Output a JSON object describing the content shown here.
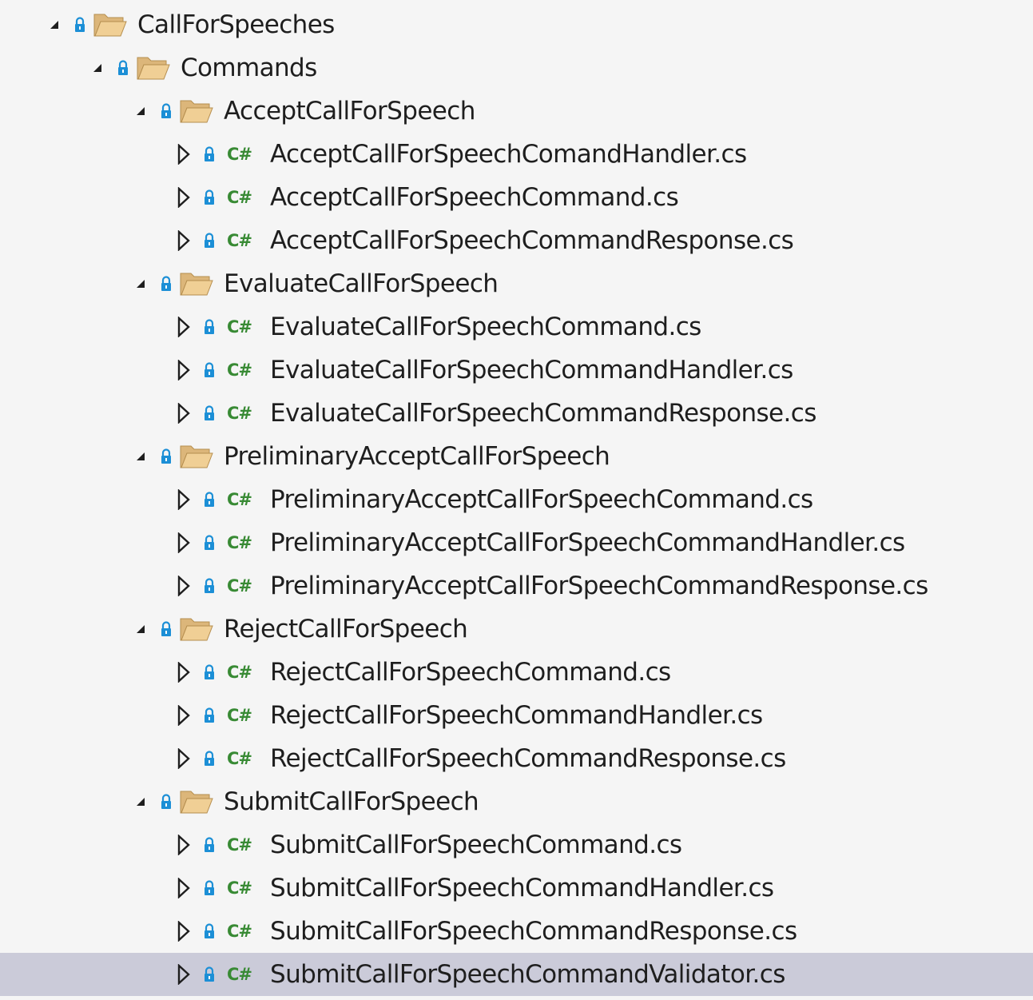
{
  "tree": {
    "items": [
      {
        "type": "folder",
        "level": 0,
        "label": "CallForSpeeches",
        "expanded": true
      },
      {
        "type": "folder",
        "level": 1,
        "label": "Commands",
        "expanded": true
      },
      {
        "type": "folder",
        "level": 2,
        "label": "AcceptCallForSpeech",
        "expanded": true
      },
      {
        "type": "file",
        "level": 3,
        "label": "AcceptCallForSpeechComandHandler.cs",
        "expanded": false
      },
      {
        "type": "file",
        "level": 3,
        "label": "AcceptCallForSpeechCommand.cs",
        "expanded": false
      },
      {
        "type": "file",
        "level": 3,
        "label": "AcceptCallForSpeechCommandResponse.cs",
        "expanded": false
      },
      {
        "type": "folder",
        "level": 2,
        "label": "EvaluateCallForSpeech",
        "expanded": true
      },
      {
        "type": "file",
        "level": 3,
        "label": "EvaluateCallForSpeechCommand.cs",
        "expanded": false
      },
      {
        "type": "file",
        "level": 3,
        "label": "EvaluateCallForSpeechCommandHandler.cs",
        "expanded": false
      },
      {
        "type": "file",
        "level": 3,
        "label": "EvaluateCallForSpeechCommandResponse.cs",
        "expanded": false
      },
      {
        "type": "folder",
        "level": 2,
        "label": "PreliminaryAcceptCallForSpeech",
        "expanded": true
      },
      {
        "type": "file",
        "level": 3,
        "label": "PreliminaryAcceptCallForSpeechCommand.cs",
        "expanded": false
      },
      {
        "type": "file",
        "level": 3,
        "label": "PreliminaryAcceptCallForSpeechCommandHandler.cs",
        "expanded": false
      },
      {
        "type": "file",
        "level": 3,
        "label": "PreliminaryAcceptCallForSpeechCommandResponse.cs",
        "expanded": false
      },
      {
        "type": "folder",
        "level": 2,
        "label": "RejectCallForSpeech",
        "expanded": true
      },
      {
        "type": "file",
        "level": 3,
        "label": "RejectCallForSpeechCommand.cs",
        "expanded": false
      },
      {
        "type": "file",
        "level": 3,
        "label": "RejectCallForSpeechCommandHandler.cs",
        "expanded": false
      },
      {
        "type": "file",
        "level": 3,
        "label": "RejectCallForSpeechCommandResponse.cs",
        "expanded": false
      },
      {
        "type": "folder",
        "level": 2,
        "label": "SubmitCallForSpeech",
        "expanded": true
      },
      {
        "type": "file",
        "level": 3,
        "label": "SubmitCallForSpeechCommand.cs",
        "expanded": false
      },
      {
        "type": "file",
        "level": 3,
        "label": "SubmitCallForSpeechCommandHandler.cs",
        "expanded": false
      },
      {
        "type": "file",
        "level": 3,
        "label": "SubmitCallForSpeechCommandResponse.cs",
        "expanded": false
      },
      {
        "type": "file",
        "level": 3,
        "label": "SubmitCallForSpeechCommandValidator.cs",
        "expanded": false,
        "selected": true
      }
    ],
    "file_icon_text": "C#",
    "colors": {
      "background": "#f5f5f5",
      "selection": "#cbcbd9",
      "text": "#1e1e1e",
      "csharp": "#388a34",
      "lock": "#1c8fd6",
      "folder": "#dcb67a"
    }
  }
}
